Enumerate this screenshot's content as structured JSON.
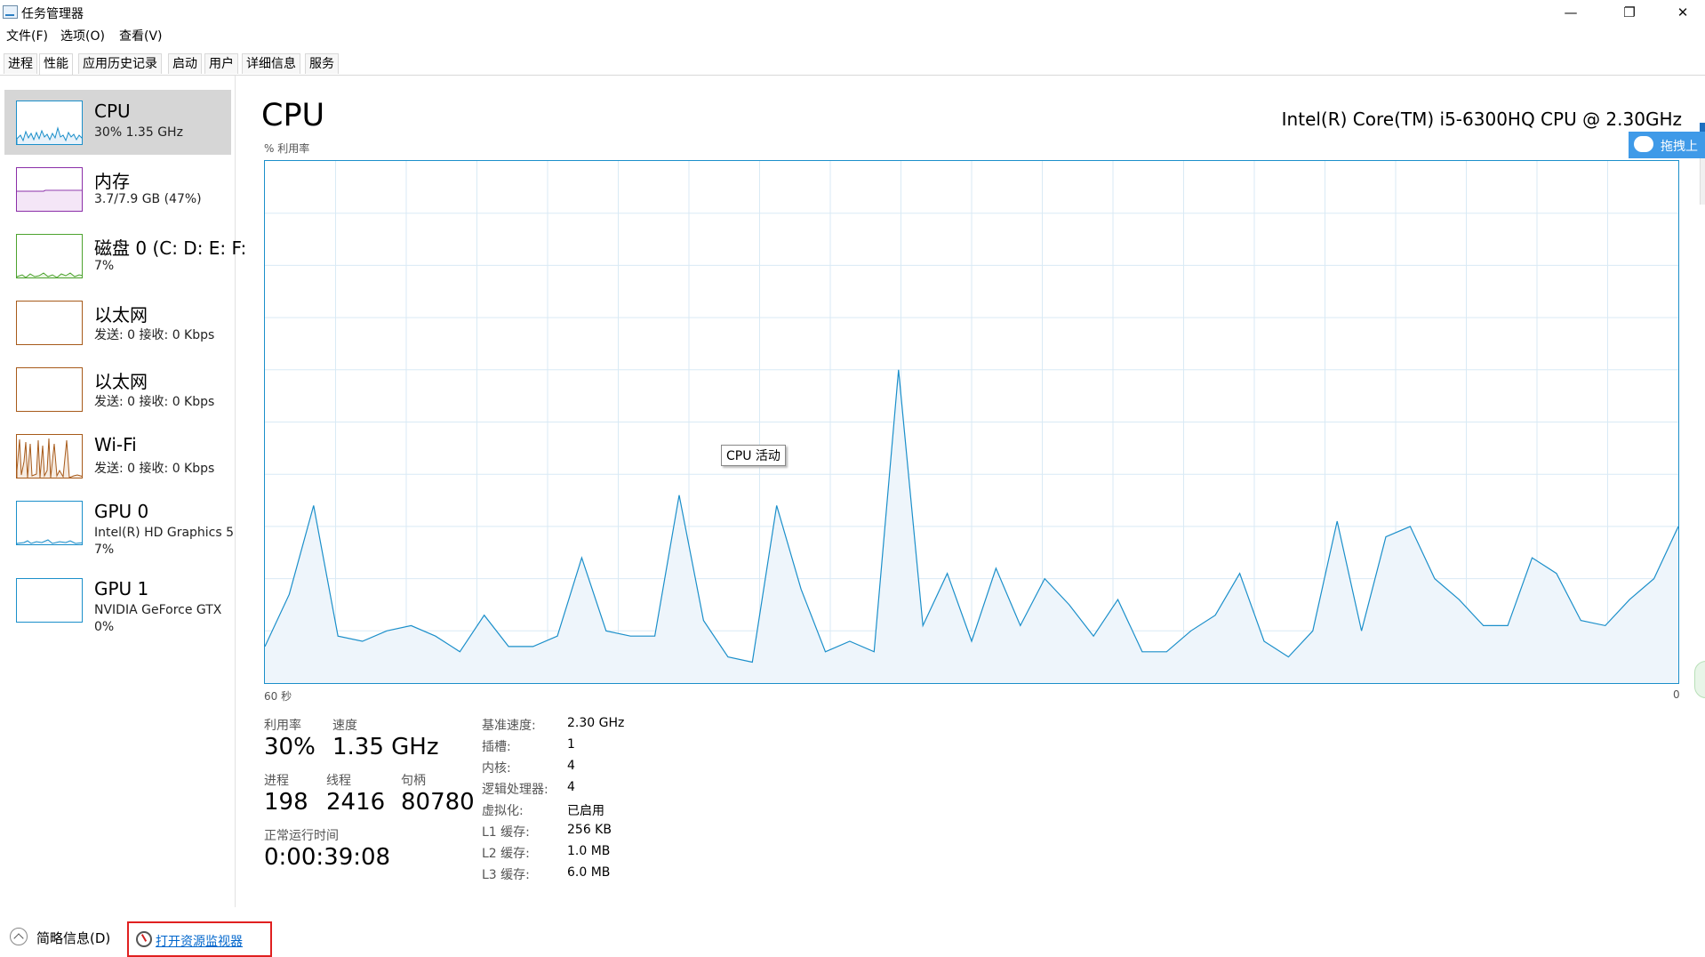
{
  "window": {
    "title": "任务管理器",
    "controls": {
      "minimize": "—",
      "maximize": "❐",
      "close": "✕"
    }
  },
  "menu": [
    "文件(F)",
    "选项(O)",
    "查看(V)"
  ],
  "tabs": [
    {
      "label": "进程",
      "active": false
    },
    {
      "label": "性能",
      "active": true
    },
    {
      "label": "应用历史记录",
      "active": false
    },
    {
      "label": "启动",
      "active": false
    },
    {
      "label": "用户",
      "active": false
    },
    {
      "label": "详细信息",
      "active": false
    },
    {
      "label": "服务",
      "active": false
    }
  ],
  "sidebar": [
    {
      "title": "CPU",
      "line1": "30% 1.35 GHz",
      "line2": "",
      "color": "#1b8fca",
      "active": true
    },
    {
      "title": "内存",
      "line1": "3.7/7.9 GB (47%)",
      "line2": "",
      "color": "#8b2fa8",
      "active": false
    },
    {
      "title": "磁盘 0 (C: D: E: F:",
      "line1": "7%",
      "line2": "",
      "color": "#4da32f",
      "active": false
    },
    {
      "title": "以太网",
      "line1": "发送: 0 接收: 0 Kbps",
      "line2": "",
      "color": "#a75a1a",
      "active": false
    },
    {
      "title": "以太网",
      "line1": "发送: 0 接收: 0 Kbps",
      "line2": "",
      "color": "#a75a1a",
      "active": false
    },
    {
      "title": "Wi-Fi",
      "line1": "发送: 0 接收: 0 Kbps",
      "line2": "",
      "color": "#a75a1a",
      "active": false
    },
    {
      "title": "GPU 0",
      "line1": "Intel(R) HD Graphics 5",
      "line2": "7%",
      "color": "#1b8fca",
      "active": false
    },
    {
      "title": "GPU 1",
      "line1": "NVIDIA GeForce GTX",
      "line2": "0%",
      "color": "#1b8fca",
      "active": false
    }
  ],
  "main": {
    "title": "CPU",
    "cpu_model": "Intel(R) Core(TM) i5-6300HQ CPU @ 2.30GHz",
    "util_label": "% 利用率",
    "axis_left": "60 秒",
    "axis_right": "0",
    "tooltip": "CPU 活动",
    "graph_color": "#1b8fca",
    "graph_values": [
      7,
      17,
      34,
      9,
      8,
      10,
      11,
      9,
      6,
      13,
      7,
      7,
      9,
      24,
      10,
      9,
      9,
      36,
      12,
      5,
      4,
      34,
      18,
      6,
      8,
      6,
      60,
      11,
      21,
      8,
      22,
      11,
      20,
      15,
      9,
      16,
      6,
      6,
      10,
      13,
      21,
      8,
      5,
      10,
      31,
      10,
      28,
      30,
      20,
      16,
      11,
      11,
      24,
      21,
      12,
      11,
      16,
      20,
      30
    ]
  },
  "stats": {
    "utilization": {
      "label": "利用率",
      "value": "30%"
    },
    "speed": {
      "label": "速度",
      "value": "1.35 GHz"
    },
    "processes": {
      "label": "进程",
      "value": "198"
    },
    "threads": {
      "label": "线程",
      "value": "2416"
    },
    "handles": {
      "label": "句柄",
      "value": "80780"
    },
    "uptime": {
      "label": "正常运行时间",
      "value": "0:00:39:08"
    }
  },
  "specs": [
    {
      "label": "基准速度:",
      "value": "2.30 GHz"
    },
    {
      "label": "插槽:",
      "value": "1"
    },
    {
      "label": "内核:",
      "value": "4"
    },
    {
      "label": "逻辑处理器:",
      "value": "4"
    },
    {
      "label": "虚拟化:",
      "value": "已启用"
    },
    {
      "label": "L1 缓存:",
      "value": "256 KB"
    },
    {
      "label": "L2 缓存:",
      "value": "1.0 MB"
    },
    {
      "label": "L3 缓存:",
      "value": "6.0 MB"
    }
  ],
  "footer": {
    "brief": "简略信息(D)",
    "resource_monitor": "打开资源监视器"
  },
  "overlay_widget": {
    "label": "拖拽上"
  }
}
